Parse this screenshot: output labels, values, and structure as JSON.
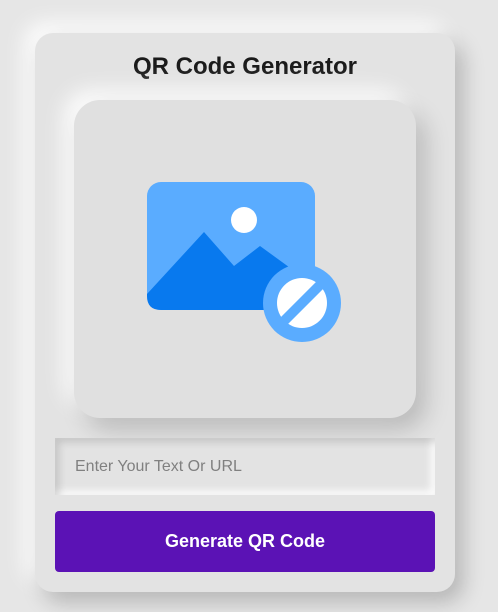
{
  "app": {
    "title": "QR Code Generator"
  },
  "preview": {
    "icon": "image-blocked-icon",
    "colors": {
      "frame": "#5aacff",
      "mountains": "#0879ee",
      "sun": "#ffffff",
      "badge": "#5aacff"
    }
  },
  "input": {
    "placeholder": "Enter Your Text Or URL",
    "value": ""
  },
  "button": {
    "label": "Generate QR Code",
    "color": "#5b12b5"
  }
}
